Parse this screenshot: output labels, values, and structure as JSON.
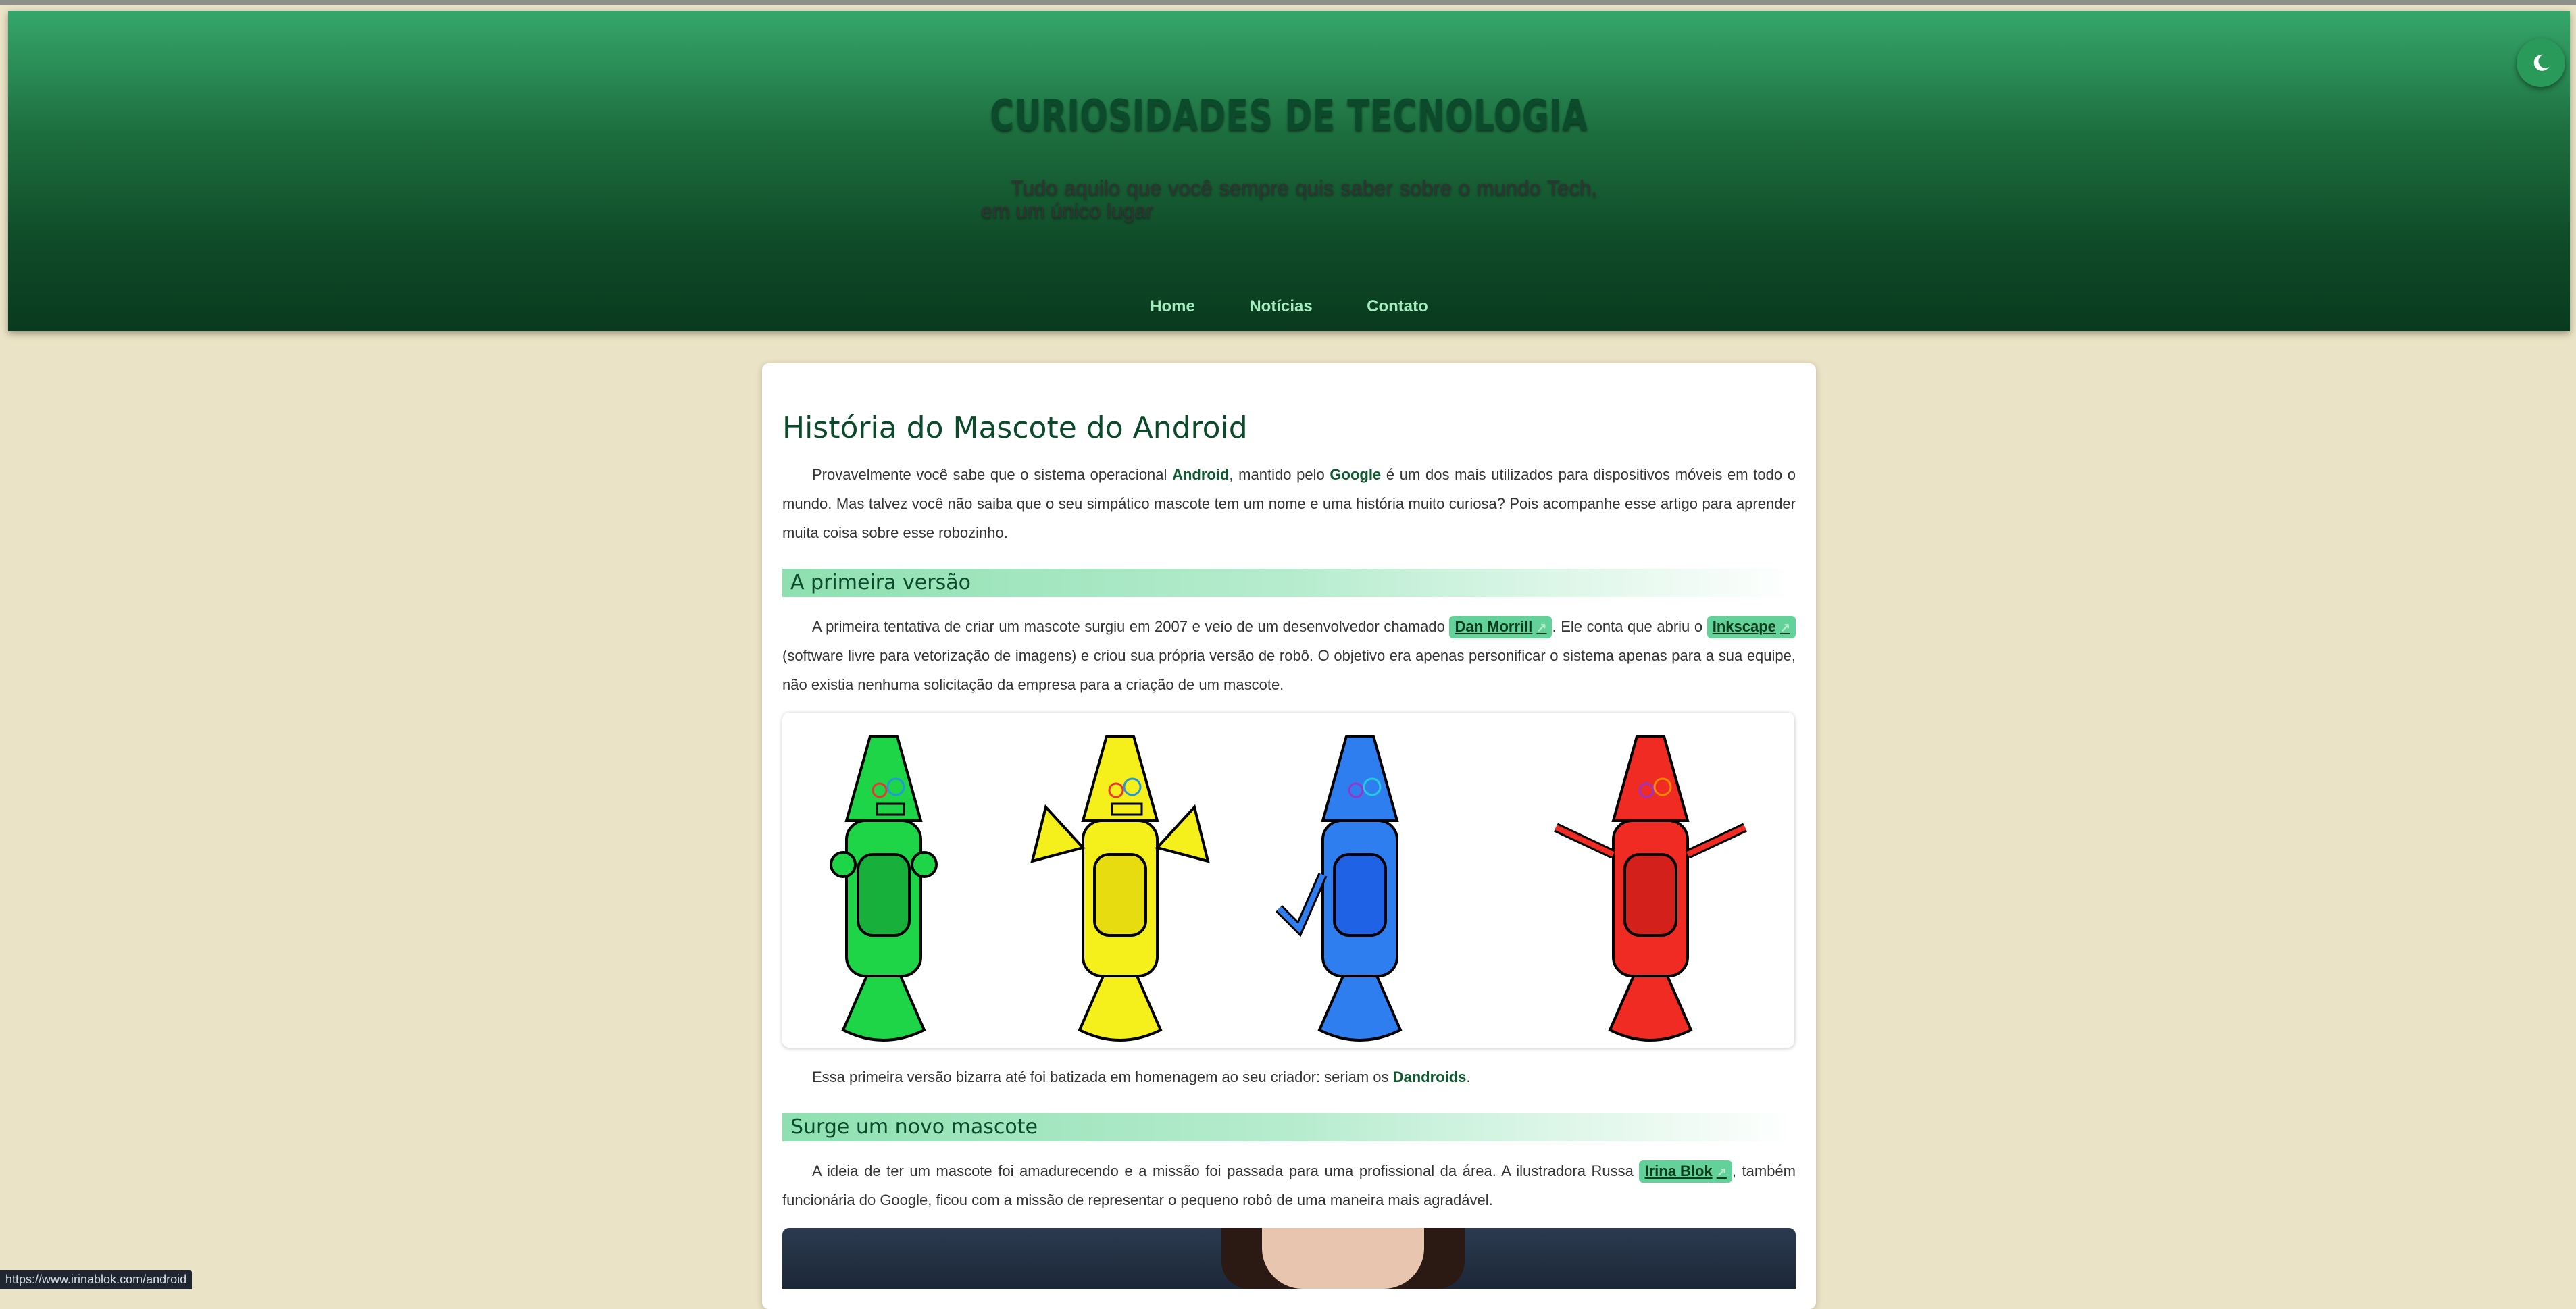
{
  "header": {
    "title": "CURIOSIDADES DE TECNOLOGIA",
    "subtitle": "Tudo aquilo que você sempre quis saber sobre o mundo Tech, em um único lugar",
    "nav": [
      "Home",
      "Notícias",
      "Contato"
    ],
    "theme_toggle_icon": "moon-icon"
  },
  "article": {
    "title": "História do Mascote do Android",
    "intro": {
      "t1": "Provavelmente você sabe que o sistema operacional ",
      "b1": "Android",
      "t2": ", mantido pelo ",
      "b2": "Google",
      "t3": " é um dos mais utilizados para dispositivos móveis em todo o mundo. Mas talvez você não saiba que o seu simpático mascote tem um nome e uma história muito curiosa? Pois acompanhe esse artigo para aprender muita coisa sobre esse robozinho."
    },
    "section1": {
      "heading": "A primeira versão",
      "p1": {
        "t1": "A primeira tentativa de criar um mascote surgiu em 2007 e veio de um desenvolvedor chamado ",
        "link1": "Dan Morrill",
        "t2": ". Ele conta que abriu o ",
        "link2": "Inkscape",
        "t3": " (software livre para vetorização de imagens) e criou sua própria versão de robô. O objetivo era apenas personificar o sistema apenas para a sua equipe, não existia nenhuma solicitação da empresa para a criação de um mascote."
      },
      "figure_colors": [
        "#1ed548",
        "#f5f01c",
        "#2f7ef0",
        "#ef2b24"
      ],
      "p2": {
        "t1": "Essa primeira versão bizarra até foi batizada em homenagem ao seu criador: seriam os ",
        "b1": "Dandroids",
        "t2": "."
      }
    },
    "section2": {
      "heading": "Surge um novo mascote",
      "p1": {
        "t1": "A ideia de ter um mascote foi amadurecendo e a missão foi passada para uma profissional da área. A ilustradora Russa ",
        "link1": "Irina Blok",
        "t2": ", também funcionária do Google, ficou com a missão de representar o pequeno robô de uma maneira mais agradável."
      }
    }
  },
  "status_bar": {
    "url": "https://www.irinablok.com/android"
  }
}
